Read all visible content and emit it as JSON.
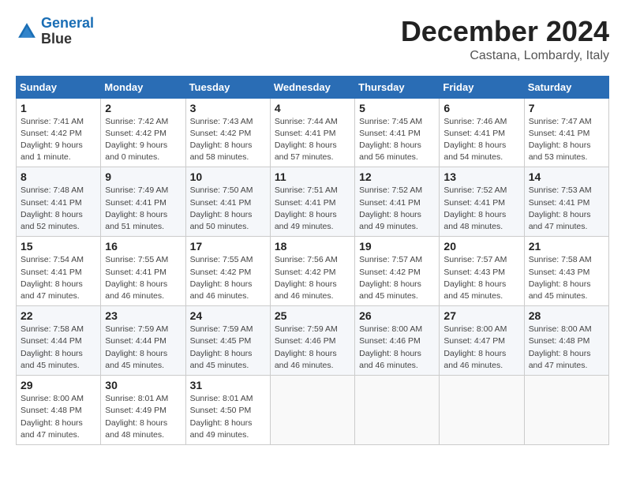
{
  "header": {
    "logo_line1": "General",
    "logo_line2": "Blue",
    "month": "December 2024",
    "location": "Castana, Lombardy, Italy"
  },
  "weekdays": [
    "Sunday",
    "Monday",
    "Tuesday",
    "Wednesday",
    "Thursday",
    "Friday",
    "Saturday"
  ],
  "weeks": [
    [
      {
        "day": "1",
        "info": "Sunrise: 7:41 AM\nSunset: 4:42 PM\nDaylight: 9 hours\nand 1 minute."
      },
      {
        "day": "2",
        "info": "Sunrise: 7:42 AM\nSunset: 4:42 PM\nDaylight: 9 hours\nand 0 minutes."
      },
      {
        "day": "3",
        "info": "Sunrise: 7:43 AM\nSunset: 4:42 PM\nDaylight: 8 hours\nand 58 minutes."
      },
      {
        "day": "4",
        "info": "Sunrise: 7:44 AM\nSunset: 4:41 PM\nDaylight: 8 hours\nand 57 minutes."
      },
      {
        "day": "5",
        "info": "Sunrise: 7:45 AM\nSunset: 4:41 PM\nDaylight: 8 hours\nand 56 minutes."
      },
      {
        "day": "6",
        "info": "Sunrise: 7:46 AM\nSunset: 4:41 PM\nDaylight: 8 hours\nand 54 minutes."
      },
      {
        "day": "7",
        "info": "Sunrise: 7:47 AM\nSunset: 4:41 PM\nDaylight: 8 hours\nand 53 minutes."
      }
    ],
    [
      {
        "day": "8",
        "info": "Sunrise: 7:48 AM\nSunset: 4:41 PM\nDaylight: 8 hours\nand 52 minutes."
      },
      {
        "day": "9",
        "info": "Sunrise: 7:49 AM\nSunset: 4:41 PM\nDaylight: 8 hours\nand 51 minutes."
      },
      {
        "day": "10",
        "info": "Sunrise: 7:50 AM\nSunset: 4:41 PM\nDaylight: 8 hours\nand 50 minutes."
      },
      {
        "day": "11",
        "info": "Sunrise: 7:51 AM\nSunset: 4:41 PM\nDaylight: 8 hours\nand 49 minutes."
      },
      {
        "day": "12",
        "info": "Sunrise: 7:52 AM\nSunset: 4:41 PM\nDaylight: 8 hours\nand 49 minutes."
      },
      {
        "day": "13",
        "info": "Sunrise: 7:52 AM\nSunset: 4:41 PM\nDaylight: 8 hours\nand 48 minutes."
      },
      {
        "day": "14",
        "info": "Sunrise: 7:53 AM\nSunset: 4:41 PM\nDaylight: 8 hours\nand 47 minutes."
      }
    ],
    [
      {
        "day": "15",
        "info": "Sunrise: 7:54 AM\nSunset: 4:41 PM\nDaylight: 8 hours\nand 47 minutes."
      },
      {
        "day": "16",
        "info": "Sunrise: 7:55 AM\nSunset: 4:41 PM\nDaylight: 8 hours\nand 46 minutes."
      },
      {
        "day": "17",
        "info": "Sunrise: 7:55 AM\nSunset: 4:42 PM\nDaylight: 8 hours\nand 46 minutes."
      },
      {
        "day": "18",
        "info": "Sunrise: 7:56 AM\nSunset: 4:42 PM\nDaylight: 8 hours\nand 46 minutes."
      },
      {
        "day": "19",
        "info": "Sunrise: 7:57 AM\nSunset: 4:42 PM\nDaylight: 8 hours\nand 45 minutes."
      },
      {
        "day": "20",
        "info": "Sunrise: 7:57 AM\nSunset: 4:43 PM\nDaylight: 8 hours\nand 45 minutes."
      },
      {
        "day": "21",
        "info": "Sunrise: 7:58 AM\nSunset: 4:43 PM\nDaylight: 8 hours\nand 45 minutes."
      }
    ],
    [
      {
        "day": "22",
        "info": "Sunrise: 7:58 AM\nSunset: 4:44 PM\nDaylight: 8 hours\nand 45 minutes."
      },
      {
        "day": "23",
        "info": "Sunrise: 7:59 AM\nSunset: 4:44 PM\nDaylight: 8 hours\nand 45 minutes."
      },
      {
        "day": "24",
        "info": "Sunrise: 7:59 AM\nSunset: 4:45 PM\nDaylight: 8 hours\nand 45 minutes."
      },
      {
        "day": "25",
        "info": "Sunrise: 7:59 AM\nSunset: 4:46 PM\nDaylight: 8 hours\nand 46 minutes."
      },
      {
        "day": "26",
        "info": "Sunrise: 8:00 AM\nSunset: 4:46 PM\nDaylight: 8 hours\nand 46 minutes."
      },
      {
        "day": "27",
        "info": "Sunrise: 8:00 AM\nSunset: 4:47 PM\nDaylight: 8 hours\nand 46 minutes."
      },
      {
        "day": "28",
        "info": "Sunrise: 8:00 AM\nSunset: 4:48 PM\nDaylight: 8 hours\nand 47 minutes."
      }
    ],
    [
      {
        "day": "29",
        "info": "Sunrise: 8:00 AM\nSunset: 4:48 PM\nDaylight: 8 hours\nand 47 minutes."
      },
      {
        "day": "30",
        "info": "Sunrise: 8:01 AM\nSunset: 4:49 PM\nDaylight: 8 hours\nand 48 minutes."
      },
      {
        "day": "31",
        "info": "Sunrise: 8:01 AM\nSunset: 4:50 PM\nDaylight: 8 hours\nand 49 minutes."
      },
      null,
      null,
      null,
      null
    ]
  ]
}
